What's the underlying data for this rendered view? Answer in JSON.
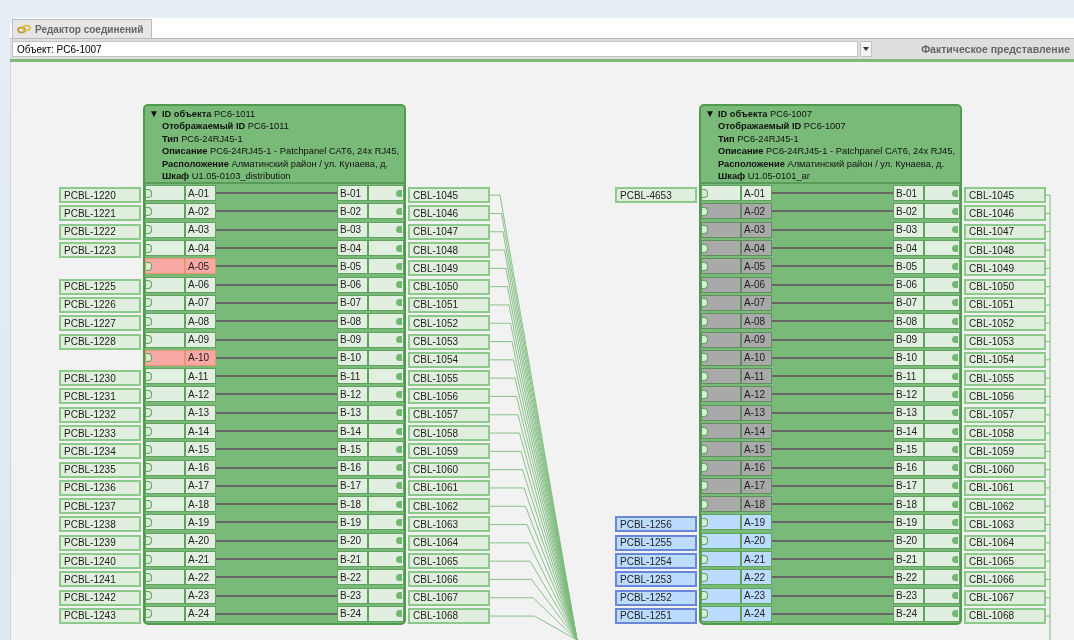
{
  "tab": {
    "label": "Редактор соединений"
  },
  "object_select": {
    "value": "Объект: PC6-1007"
  },
  "view_label": "Фактическое представление",
  "panels": [
    {
      "toggle": "▼",
      "lines": [
        "**ID объекта** PC6-1011",
        "**Отображаемый ID** PC6-1011",
        "**Тип** PC6-24RJ45-1",
        "**Описание** PC6-24RJ45-1 - Patchpanel CAT6, 24x RJ45,",
        "**Расположение** Алматинский район / ул. Кунаева, д.",
        "**Шкаф** U1.05-0103_distribution"
      ],
      "rows": [
        {
          "a_cable": "PCBL-1220",
          "a_port": "A-01",
          "kind": "normal",
          "b_port": "B-01",
          "b_cable": "CBL-1045"
        },
        {
          "a_cable": "PCBL-1221",
          "a_port": "A-02",
          "kind": "normal",
          "b_port": "B-02",
          "b_cable": "CBL-1046"
        },
        {
          "a_cable": "PCBL-1222",
          "a_port": "A-03",
          "kind": "normal",
          "b_port": "B-03",
          "b_cable": "CBL-1047"
        },
        {
          "a_cable": "PCBL-1223",
          "a_port": "A-04",
          "kind": "normal",
          "b_port": "B-04",
          "b_cable": "CBL-1048"
        },
        {
          "a_port": "A-05",
          "kind": "alert",
          "b_port": "B-05",
          "b_cable": "CBL-1049"
        },
        {
          "a_cable": "PCBL-1225",
          "a_port": "A-06",
          "kind": "normal",
          "b_port": "B-06",
          "b_cable": "CBL-1050"
        },
        {
          "a_cable": "PCBL-1226",
          "a_port": "A-07",
          "kind": "normal",
          "b_port": "B-07",
          "b_cable": "CBL-1051"
        },
        {
          "a_cable": "PCBL-1227",
          "a_port": "A-08",
          "kind": "normal",
          "b_port": "B-08",
          "b_cable": "CBL-1052"
        },
        {
          "a_cable": "PCBL-1228",
          "a_port": "A-09",
          "kind": "normal",
          "b_port": "B-09",
          "b_cable": "CBL-1053"
        },
        {
          "a_port": "A-10",
          "kind": "alert",
          "b_port": "B-10",
          "b_cable": "CBL-1054"
        },
        {
          "a_cable": "PCBL-1230",
          "a_port": "A-11",
          "kind": "normal",
          "b_port": "B-11",
          "b_cable": "CBL-1055"
        },
        {
          "a_cable": "PCBL-1231",
          "a_port": "A-12",
          "kind": "normal",
          "b_port": "B-12",
          "b_cable": "CBL-1056"
        },
        {
          "a_cable": "PCBL-1232",
          "a_port": "A-13",
          "kind": "normal",
          "b_port": "B-13",
          "b_cable": "CBL-1057"
        },
        {
          "a_cable": "PCBL-1233",
          "a_port": "A-14",
          "kind": "normal",
          "b_port": "B-14",
          "b_cable": "CBL-1058"
        },
        {
          "a_cable": "PCBL-1234",
          "a_port": "A-15",
          "kind": "normal",
          "b_port": "B-15",
          "b_cable": "CBL-1059"
        },
        {
          "a_cable": "PCBL-1235",
          "a_port": "A-16",
          "kind": "normal",
          "b_port": "B-16",
          "b_cable": "CBL-1060"
        },
        {
          "a_cable": "PCBL-1236",
          "a_port": "A-17",
          "kind": "normal",
          "b_port": "B-17",
          "b_cable": "CBL-1061"
        },
        {
          "a_cable": "PCBL-1237",
          "a_port": "A-18",
          "kind": "normal",
          "b_port": "B-18",
          "b_cable": "CBL-1062"
        },
        {
          "a_cable": "PCBL-1238",
          "a_port": "A-19",
          "kind": "normal",
          "b_port": "B-19",
          "b_cable": "CBL-1063"
        },
        {
          "a_cable": "PCBL-1239",
          "a_port": "A-20",
          "kind": "normal",
          "b_port": "B-20",
          "b_cable": "CBL-1064"
        },
        {
          "a_cable": "PCBL-1240",
          "a_port": "A-21",
          "kind": "normal",
          "b_port": "B-21",
          "b_cable": "CBL-1065"
        },
        {
          "a_cable": "PCBL-1241",
          "a_port": "A-22",
          "kind": "normal",
          "b_port": "B-22",
          "b_cable": "CBL-1066"
        },
        {
          "a_cable": "PCBL-1242",
          "a_port": "A-23",
          "kind": "normal",
          "b_port": "B-23",
          "b_cable": "CBL-1067"
        },
        {
          "a_cable": "PCBL-1243",
          "a_port": "A-24",
          "kind": "normal",
          "b_port": "B-24",
          "b_cable": "CBL-1068"
        }
      ]
    },
    {
      "toggle": "▼",
      "lines": [
        "**ID объекта** PC6-1007",
        "**Отображаемый ID** PC6-1007",
        "**Тип** PC6-24RJ45-1",
        "**Описание** PC6-24RJ45-1 - Patchpanel CAT6, 24x RJ45,",
        "**Расположение** Алматинский район / ул. Кунаева, д.",
        "**Шкаф** U1.05-0101_ar"
      ],
      "rows": [
        {
          "a_cable": "PCBL-4653",
          "a_port": "A-01",
          "kind": "normal",
          "b_port": "B-01",
          "b_cable": "CBL-1045"
        },
        {
          "a_port": "A-02",
          "kind": "inactive",
          "b_port": "B-02",
          "b_cable": "CBL-1046"
        },
        {
          "a_port": "A-03",
          "kind": "inactive",
          "b_port": "B-03",
          "b_cable": "CBL-1047"
        },
        {
          "a_port": "A-04",
          "kind": "inactive",
          "b_port": "B-04",
          "b_cable": "CBL-1048"
        },
        {
          "a_port": "A-05",
          "kind": "inactive",
          "b_port": "B-05",
          "b_cable": "CBL-1049"
        },
        {
          "a_port": "A-06",
          "kind": "inactive",
          "b_port": "B-06",
          "b_cable": "CBL-1050"
        },
        {
          "a_port": "A-07",
          "kind": "inactive",
          "b_port": "B-07",
          "b_cable": "CBL-1051"
        },
        {
          "a_port": "A-08",
          "kind": "inactive",
          "b_port": "B-08",
          "b_cable": "CBL-1052"
        },
        {
          "a_port": "A-09",
          "kind": "inactive",
          "b_port": "B-09",
          "b_cable": "CBL-1053"
        },
        {
          "a_port": "A-10",
          "kind": "inactive",
          "b_port": "B-10",
          "b_cable": "CBL-1054"
        },
        {
          "a_port": "A-11",
          "kind": "inactive",
          "b_port": "B-11",
          "b_cable": "CBL-1055"
        },
        {
          "a_port": "A-12",
          "kind": "inactive",
          "b_port": "B-12",
          "b_cable": "CBL-1056"
        },
        {
          "a_port": "A-13",
          "kind": "inactive",
          "b_port": "B-13",
          "b_cable": "CBL-1057"
        },
        {
          "a_port": "A-14",
          "kind": "inactive",
          "b_port": "B-14",
          "b_cable": "CBL-1058"
        },
        {
          "a_port": "A-15",
          "kind": "inactive",
          "b_port": "B-15",
          "b_cable": "CBL-1059"
        },
        {
          "a_port": "A-16",
          "kind": "inactive",
          "b_port": "B-16",
          "b_cable": "CBL-1060"
        },
        {
          "a_port": "A-17",
          "kind": "inactive",
          "b_port": "B-17",
          "b_cable": "CBL-1061"
        },
        {
          "a_port": "A-18",
          "kind": "inactive",
          "b_port": "B-18",
          "b_cable": "CBL-1062"
        },
        {
          "a_cable": "PCBL-1256",
          "a_port": "A-19",
          "kind": "selected",
          "b_port": "B-19",
          "b_cable": "CBL-1063"
        },
        {
          "a_cable": "PCBL-1255",
          "a_port": "A-20",
          "kind": "selected",
          "b_port": "B-20",
          "b_cable": "CBL-1064"
        },
        {
          "a_cable": "PCBL-1254",
          "a_port": "A-21",
          "kind": "selected",
          "b_port": "B-21",
          "b_cable": "CBL-1065"
        },
        {
          "a_cable": "PCBL-1253",
          "a_port": "A-22",
          "kind": "selected",
          "b_port": "B-22",
          "b_cable": "CBL-1066"
        },
        {
          "a_cable": "PCBL-1252",
          "a_port": "A-23",
          "kind": "selected",
          "b_port": "B-23",
          "b_cable": "CBL-1067"
        },
        {
          "a_cable": "PCBL-1251",
          "a_port": "A-24",
          "kind": "selected",
          "b_port": "B-24",
          "b_cable": "CBL-1068"
        }
      ]
    }
  ]
}
